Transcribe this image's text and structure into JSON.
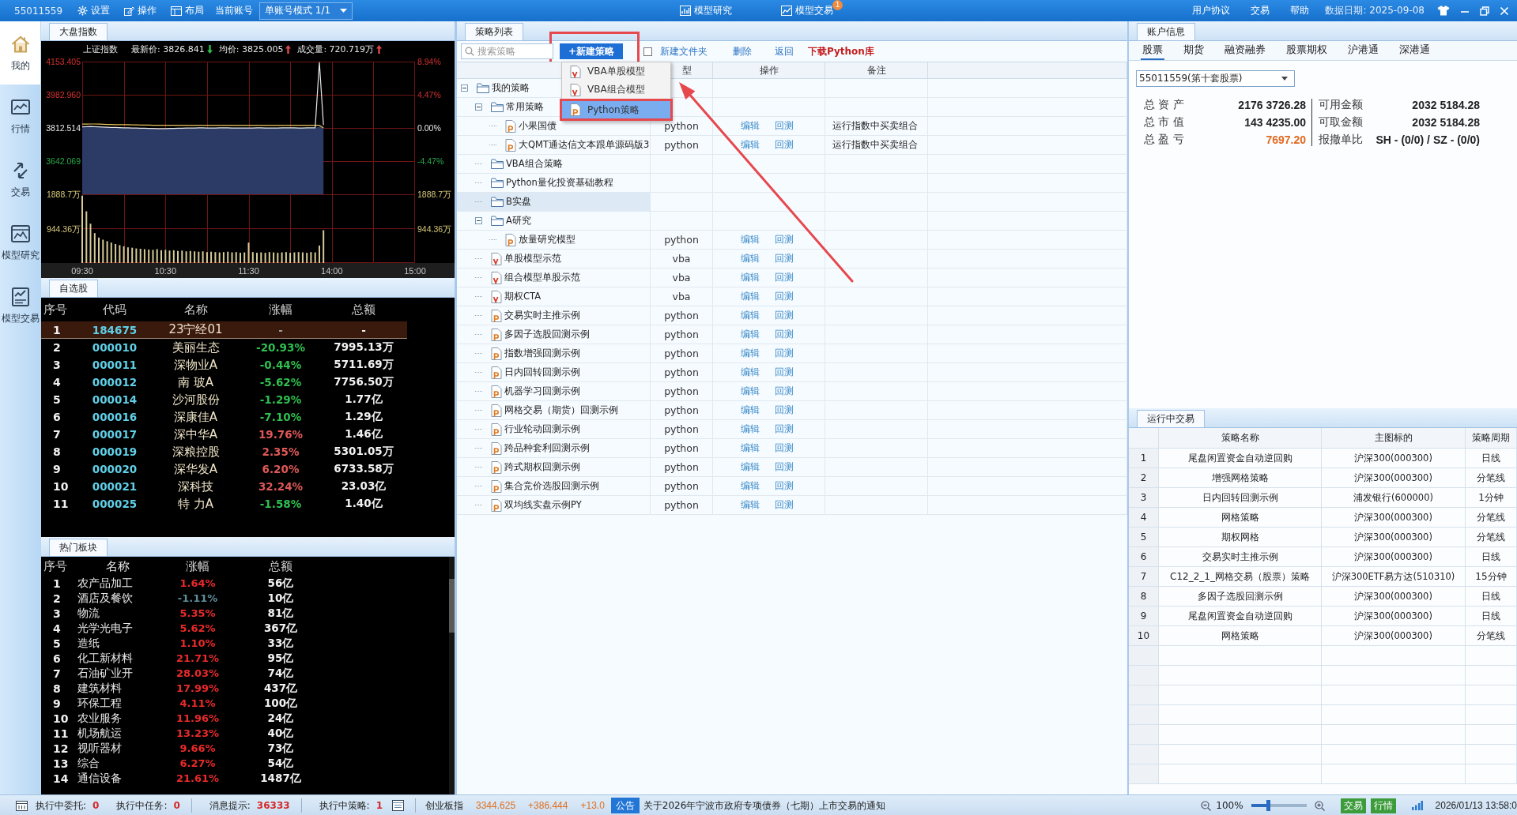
{
  "top_bar": {
    "account": "55011559",
    "menu": [
      {
        "kind": "gear",
        "label": "设置"
      },
      {
        "kind": "edit",
        "label": "操作"
      },
      {
        "kind": "layout",
        "label": "布局"
      }
    ],
    "account_label": "当前账号",
    "account_mode": "单账号模式 1/1",
    "modes": [
      {
        "kind": "research",
        "label": "模型研究"
      },
      {
        "kind": "trade",
        "label": "模型交易",
        "badge": "1"
      }
    ],
    "links": [
      "用户协议",
      "交易",
      "帮助"
    ],
    "data_date": "数据日期: 2025-09-08"
  },
  "nav": [
    {
      "kind": "home",
      "label": "我的",
      "selected": true
    },
    {
      "kind": "market",
      "label": "行情",
      "selected": false
    },
    {
      "kind": "trade",
      "label": "交易",
      "selected": false
    },
    {
      "kind": "research",
      "label": "模型研究",
      "selected": false
    },
    {
      "kind": "model_trade",
      "label": "模型交易",
      "selected": false
    }
  ],
  "index_panel": {
    "tab": "大盘指数",
    "index_name": "上证指数",
    "quotes": [
      {
        "text": "最新价: 3826.841",
        "kind": "down"
      },
      {
        "text": "均价: 3825.005",
        "kind": "up"
      },
      {
        "text": "成交量: 720.719万",
        "kind": "up"
      }
    ],
    "price_chart": {
      "chart_data": {
        "type": "line",
        "categories": [
          null,
          null,
          null,
          null,
          null,
          null,
          null,
          null,
          null,
          null,
          null,
          null,
          null,
          null,
          null,
          null,
          null,
          null,
          null,
          null,
          null,
          null,
          null,
          null,
          null,
          null,
          null,
          null,
          null,
          null,
          null,
          null,
          null,
          null,
          null,
          null,
          null,
          null,
          null,
          null,
          null,
          null,
          null,
          null,
          null,
          null,
          null,
          null,
          null,
          null,
          null,
          null,
          null,
          null,
          null,
          null,
          null,
          null,
          null,
          null,
          null,
          null,
          null,
          null,
          null,
          null,
          null,
          null,
          null,
          null,
          null,
          null,
          null,
          null,
          null,
          null,
          null,
          null,
          null,
          null,
          null
        ],
        "series": [
          {
            "color": "#e8e8e8",
            "values": [
              3818,
              3819,
              3820,
              3819,
              3818,
              3817,
              3816,
              3815,
              3815,
              3814,
              3813,
              3813,
              3812,
              3812,
              3811,
              3811,
              3810,
              3810,
              3809,
              3809,
              3809,
              3810,
              3810,
              3811,
              3811,
              3812,
              3812,
              3812,
              3813,
              3813,
              3812,
              3812,
              3812,
              3813,
              3813,
              3813,
              3812,
              3812,
              3812,
              3812,
              3812,
              3812,
              3813,
              3813,
              3812,
              3812,
              3812,
              3812,
              3813,
              3813,
              3813,
              3813,
              3812,
              3812,
              3813,
              3813,
              3813,
              4150,
              3827,
              null,
              null,
              null,
              null,
              null,
              null,
              null,
              null,
              null,
              null,
              null,
              null,
              null,
              null,
              null,
              null,
              null,
              null,
              null,
              null,
              null,
              null
            ]
          },
          {
            "color": "#e6c35c",
            "values": [
              3832,
              3832,
              3833,
              3833,
              3832,
              3831,
              3830,
              3830,
              3829,
              3829,
              3829,
              3829,
              3828,
              3828,
              3827,
              3827,
              3827,
              3826,
              3826,
              3826,
              3826,
              3826,
              3826,
              3826,
              3826,
              3826,
              3826,
              3826,
              3826,
              3826,
              3826,
              3826,
              3826,
              3826,
              3826,
              3826,
              3826,
              3826,
              3826,
              3826,
              3826,
              3826,
              3826,
              3826,
              3826,
              3826,
              3826,
              3826,
              3826,
              3826,
              3826,
              3826,
              3826,
              3826,
              3826,
              3826,
              3826,
              3826,
              3813,
              null,
              null,
              null,
              null,
              null,
              null,
              null,
              null,
              null,
              null,
              null,
              null,
              null,
              null,
              null,
              null,
              null,
              null,
              null,
              null,
              null,
              null
            ]
          }
        ],
        "ylim": [
          3642.069,
          4153.405
        ],
        "yticks": [
          {
            "value": 4153.405,
            "label": "4153.405"
          },
          {
            "value": 3982.96,
            "label": "3982.960"
          },
          {
            "value": 3812.514,
            "label": "3812.514"
          },
          {
            "value": 3642.069,
            "label": "3642.069"
          }
        ]
      }
    },
    "right_ticks": [
      {
        "label": "8.94%",
        "color": "#d83030"
      },
      {
        "label": "4.47%",
        "color": "#d83030"
      },
      {
        "label": "0.00%",
        "color": "#e8e8e8"
      },
      {
        "label": "-4.47%",
        "color": "#2aa84a"
      }
    ],
    "volume_chart": {
      "chart_data": {
        "type": "bar",
        "categories": [
          "09:30",
          null,
          null,
          null,
          null,
          null,
          null,
          null,
          null,
          null,
          null,
          null,
          null,
          null,
          null,
          null,
          null,
          null,
          null,
          null,
          "10:30",
          null,
          null,
          null,
          null,
          null,
          null,
          null,
          null,
          null,
          null,
          null,
          null,
          null,
          null,
          null,
          null,
          null,
          null,
          null,
          "11:30",
          null,
          null,
          null,
          null,
          null,
          null,
          null,
          null,
          null,
          null,
          null,
          null,
          null,
          null,
          null,
          null,
          null,
          null,
          null,
          "14:00",
          null,
          null,
          null,
          null,
          null,
          null,
          null,
          null,
          null,
          null,
          null,
          null,
          null,
          null,
          null,
          null,
          null,
          null,
          null,
          "15:00"
        ],
        "series": [
          {
            "color": "#d6cc98",
            "values": [
              1850,
              1420,
              1080,
              820,
              700,
              640,
              600,
              560,
              520,
              490,
              460,
              430,
              420,
              400,
              390,
              380,
              370,
              360,
              380,
              350,
              360,
              340,
              350,
              330,
              340,
              320,
              330,
              320,
              310,
              320,
              300,
              310,
              300,
              290,
              300,
              310,
              290,
              300,
              280,
              290,
              560,
              300,
              280,
              290,
              280,
              300,
              290,
              280,
              290,
              300,
              280,
              290,
              300,
              290,
              280,
              300,
              290,
              480,
              900,
              null,
              null,
              null,
              null,
              null,
              null,
              null,
              null,
              null,
              null,
              null,
              null,
              null,
              null,
              null,
              null,
              null,
              null,
              null,
              null,
              null,
              null
            ]
          }
        ],
        "ylim": [
          0,
          1888.7
        ],
        "yticks": [
          {
            "value": 1888.7,
            "label": "1888.7万"
          },
          {
            "value": 944.36,
            "label": "944.36万"
          }
        ]
      }
    },
    "volume_right_ticks": [
      "1888.7万",
      "944.36万"
    ]
  },
  "watchlist": {
    "tab": "自选股",
    "columns": [
      "序号",
      "代码",
      "名称",
      "涨幅",
      "总额"
    ],
    "rows": [
      {
        "no": "1",
        "code": "184675",
        "name": "23宁经01",
        "change": "-",
        "total": "-",
        "color": "#9a9a9a",
        "selected": true
      },
      {
        "no": "2",
        "code": "000010",
        "name": "美丽生态",
        "change": "-20.93%",
        "total": "7995.13万",
        "color": "#2fbf4f",
        "selected": false
      },
      {
        "no": "3",
        "code": "000011",
        "name": "深物业A",
        "change": "-0.44%",
        "total": "5711.69万",
        "color": "#2fbf4f",
        "selected": false
      },
      {
        "no": "4",
        "code": "000012",
        "name": "南 玻A",
        "change": "-5.62%",
        "total": "7756.50万",
        "color": "#2fbf4f",
        "selected": false
      },
      {
        "no": "5",
        "code": "000014",
        "name": "沙河股份",
        "change": "-1.29%",
        "total": "1.77亿",
        "color": "#2fbf4f",
        "selected": false
      },
      {
        "no": "6",
        "code": "000016",
        "name": "深康佳A",
        "change": "-7.10%",
        "total": "1.29亿",
        "color": "#2fbf4f",
        "selected": false
      },
      {
        "no": "7",
        "code": "000017",
        "name": "深中华A",
        "change": "19.76%",
        "total": "1.46亿",
        "color": "#e05858",
        "selected": false
      },
      {
        "no": "8",
        "code": "000019",
        "name": "深粮控股",
        "change": "2.35%",
        "total": "5301.05万",
        "color": "#e05858",
        "selected": false
      },
      {
        "no": "9",
        "code": "000020",
        "name": "深华发A",
        "change": "6.20%",
        "total": "6733.58万",
        "color": "#e05858",
        "selected": false
      },
      {
        "no": "10",
        "code": "000021",
        "name": "深科技",
        "change": "32.24%",
        "total": "23.03亿",
        "color": "#e05858",
        "selected": false
      },
      {
        "no": "11",
        "code": "000025",
        "name": "特 力A",
        "change": "-1.58%",
        "total": "1.40亿",
        "color": "#2fbf4f",
        "selected": false
      }
    ]
  },
  "hot_sectors": {
    "tab": "热门板块",
    "columns": [
      "序号",
      "名称",
      "涨幅",
      "总额"
    ],
    "rows": [
      {
        "no": "1",
        "name": "农产品加工",
        "change": "1.64%",
        "total": "56亿",
        "color": "#ea2a2a"
      },
      {
        "no": "2",
        "name": "酒店及餐饮",
        "change": "-1.11%",
        "total": "10亿",
        "color": "#5e8e9a"
      },
      {
        "no": "3",
        "name": "物流",
        "change": "5.35%",
        "total": "81亿",
        "color": "#ea2a2a"
      },
      {
        "no": "4",
        "name": "光学光电子",
        "change": "5.62%",
        "total": "367亿",
        "color": "#ea2a2a"
      },
      {
        "no": "5",
        "name": "造纸",
        "change": "1.10%",
        "total": "33亿",
        "color": "#ea2a2a"
      },
      {
        "no": "6",
        "name": "化工新材料",
        "change": "21.71%",
        "total": "95亿",
        "color": "#ea2a2a"
      },
      {
        "no": "7",
        "name": "石油矿业开",
        "change": "28.03%",
        "total": "74亿",
        "color": "#ea2a2a"
      },
      {
        "no": "8",
        "name": "建筑材料",
        "change": "17.99%",
        "total": "437亿",
        "color": "#ea2a2a"
      },
      {
        "no": "9",
        "name": "环保工程",
        "change": "4.11%",
        "total": "100亿",
        "color": "#ea2a2a"
      },
      {
        "no": "10",
        "name": "农业服务",
        "change": "11.96%",
        "total": "24亿",
        "color": "#ea2a2a"
      },
      {
        "no": "11",
        "name": "机场航运",
        "change": "13.23%",
        "total": "40亿",
        "color": "#ea2a2a"
      },
      {
        "no": "12",
        "name": "视听器材",
        "change": "9.66%",
        "total": "73亿",
        "color": "#ea2a2a"
      },
      {
        "no": "13",
        "name": "综合",
        "change": "6.27%",
        "total": "54亿",
        "color": "#ea2a2a"
      },
      {
        "no": "14",
        "name": "通信设备",
        "change": "21.61%",
        "total": "1487亿",
        "color": "#ea2a2a"
      }
    ]
  },
  "strategy_list": {
    "tab": "策略列表",
    "search": {
      "placeholder": "搜索策略"
    },
    "new_button": {
      "label": "+新建策略",
      "highlighted": true
    },
    "toolbar_links": [
      {
        "kind": "normal",
        "label": "新建文件夹"
      },
      {
        "kind": "normal",
        "label": "删除"
      },
      {
        "kind": "normal",
        "label": "返回"
      },
      {
        "kind": "download",
        "label": "下载Python库"
      }
    ],
    "columns": [
      "型",
      "操作",
      "备注"
    ],
    "tree": [
      {
        "kind": "folder",
        "name": "我的策略",
        "expanded": true,
        "selected": false,
        "children": [
          {
            "kind": "folder",
            "name": "常用策略",
            "expanded": true,
            "selected": false,
            "children": [
              {
                "kind": "python",
                "name": "小果国债",
                "selected": false,
                "type": "python",
                "actions": [
                  "编辑",
                  "回测"
                ],
                "note": "运行指数中买卖组合"
              },
              {
                "kind": "python",
                "name": "大QMT通达信文本跟单源码版3",
                "selected": false,
                "type": "python",
                "actions": [
                  "编辑",
                  "回测"
                ],
                "note": "运行指数中买卖组合"
              }
            ]
          },
          {
            "kind": "folder",
            "name": "VBA组合策略",
            "selected": false
          },
          {
            "kind": "folder",
            "name": "Python量化投资基础教程",
            "selected": false
          },
          {
            "kind": "folder",
            "name": "B实盘",
            "selected": true
          },
          {
            "kind": "folder",
            "name": "A研究",
            "expanded": true,
            "selected": false,
            "children": [
              {
                "kind": "python",
                "name": "放量研究模型",
                "selected": false,
                "type": "python",
                "actions": [
                  "编辑",
                  "回测"
                ]
              }
            ]
          },
          {
            "kind": "vba",
            "name": "单股模型示范",
            "selected": false,
            "type": "vba",
            "actions": [
              "编辑",
              "回测"
            ]
          },
          {
            "kind": "vba",
            "name": "组合模型单股示范",
            "selected": false,
            "type": "vba",
            "actions": [
              "编辑",
              "回测"
            ]
          },
          {
            "kind": "vba",
            "name": "期权CTA",
            "selected": false,
            "type": "vba",
            "actions": [
              "编辑",
              "回测"
            ]
          },
          {
            "kind": "python",
            "name": "交易实时主推示例",
            "selected": false,
            "type": "python",
            "actions": [
              "编辑",
              "回测"
            ]
          },
          {
            "kind": "python",
            "name": "多因子选股回测示例",
            "selected": false,
            "type": "python",
            "actions": [
              "编辑",
              "回测"
            ]
          },
          {
            "kind": "python",
            "name": "指数增强回测示例",
            "selected": false,
            "type": "python",
            "actions": [
              "编辑",
              "回测"
            ]
          },
          {
            "kind": "python",
            "name": "日内回转回测示例",
            "selected": false,
            "type": "python",
            "actions": [
              "编辑",
              "回测"
            ]
          },
          {
            "kind": "python",
            "name": "机器学习回测示例",
            "selected": false,
            "type": "python",
            "actions": [
              "编辑",
              "回测"
            ]
          },
          {
            "kind": "python",
            "name": "网格交易（期货）回测示例",
            "selected": false,
            "type": "python",
            "actions": [
              "编辑",
              "回测"
            ]
          },
          {
            "kind": "python",
            "name": "行业轮动回测示例",
            "selected": false,
            "type": "python",
            "actions": [
              "编辑",
              "回测"
            ]
          },
          {
            "kind": "python",
            "name": "跨品种套利回测示例",
            "selected": false,
            "type": "python",
            "actions": [
              "编辑",
              "回测"
            ]
          },
          {
            "kind": "python",
            "name": "跨式期权回测示例",
            "selected": false,
            "type": "python",
            "actions": [
              "编辑",
              "回测"
            ]
          },
          {
            "kind": "python",
            "name": "集合竞价选股回测示例",
            "selected": false,
            "type": "python",
            "actions": [
              "编辑",
              "回测"
            ]
          },
          {
            "kind": "python",
            "name": "双均线实盘示例PY",
            "selected": false,
            "type": "python",
            "actions": [
              "编辑",
              "回测"
            ]
          }
        ]
      }
    ],
    "new_menu": [
      {
        "kind": "vba",
        "label": "VBA单股模型",
        "selected": false,
        "highlighted": false
      },
      {
        "kind": "vba",
        "label": "VBA组合模型",
        "selected": false,
        "highlighted": false
      },
      {
        "kind": "python",
        "label": "Python策略",
        "selected": true,
        "highlighted": true
      }
    ],
    "callout_arrow": true
  },
  "account_info": {
    "tab": "账户信息",
    "tabs": [
      {
        "label": "股票",
        "selected": true
      },
      {
        "label": "期货",
        "selected": false
      },
      {
        "label": "融资融券",
        "selected": false
      },
      {
        "label": "股票期权",
        "selected": false
      },
      {
        "label": "沪港通",
        "selected": false
      },
      {
        "label": "深港通",
        "selected": false
      }
    ],
    "account_select": "55011559(第十套股票)",
    "left_fields": [
      {
        "label": "总 资 产",
        "value": "2176 3726.28",
        "kind": "plain"
      },
      {
        "label": "总 市 值",
        "value": "143 4235.00",
        "kind": "plain"
      },
      {
        "label": "总 盈 亏",
        "value": "7697.20",
        "kind": "gain"
      }
    ],
    "right_fields": [
      {
        "label": "可用金额",
        "value": "2032 5184.28",
        "kind": "plain"
      },
      {
        "label": "可取金额",
        "value": "2032 5184.28",
        "kind": "plain"
      },
      {
        "label": "报撤单比",
        "value": "SH - (0/0) / SZ - (0/0)",
        "kind": "plain"
      }
    ]
  },
  "running_trades": {
    "tab": "运行中交易",
    "columns": [
      "策略名称",
      "主图标的",
      "策略周期"
    ],
    "rows": [
      {
        "no": "1",
        "name": "尾盘闲置资金自动逆回购",
        "symbol": "沪深300(000300)",
        "period": "日线"
      },
      {
        "no": "2",
        "name": "增强网格策略",
        "symbol": "沪深300(000300)",
        "period": "分笔线"
      },
      {
        "no": "3",
        "name": "日内回转回测示例",
        "symbol": "浦发银行(600000)",
        "period": "1分钟"
      },
      {
        "no": "4",
        "name": "网格策略",
        "symbol": "沪深300(000300)",
        "period": "分笔线"
      },
      {
        "no": "5",
        "name": "期权网格",
        "symbol": "沪深300(000300)",
        "period": "分笔线"
      },
      {
        "no": "6",
        "name": "交易实时主推示例",
        "symbol": "沪深300(000300)",
        "period": "日线"
      },
      {
        "no": "7",
        "name": "C12_2_1_网格交易（股票）策略",
        "symbol": "沪深300ETF易方达(510310)",
        "period": "15分钟"
      },
      {
        "no": "8",
        "name": "多因子选股回测示例",
        "symbol": "沪深300(000300)",
        "period": "日线"
      },
      {
        "no": "9",
        "name": "尾盘闲置资金自动逆回购",
        "symbol": "沪深300(000300)",
        "period": "日线"
      },
      {
        "no": "10",
        "name": "网格策略",
        "symbol": "沪深300(000300)",
        "period": "分笔线"
      }
    ]
  },
  "status_bar": {
    "counters": [
      {
        "label": "执行中委托:",
        "value": "0"
      },
      {
        "label": "执行中任务:",
        "value": "0"
      },
      {
        "label": "消息提示:",
        "value": "36333"
      },
      {
        "label": "执行中策略:",
        "value": "1"
      }
    ],
    "index_name": "创业板指",
    "index_values": [
      "3344.625",
      "+386.444",
      "+13.0"
    ],
    "notice_tag": "公告",
    "notice": "关于2026年宁波市政府专项债券（七期）上市交易的通知",
    "zoom": {
      "label": "100%",
      "level": 0.3
    },
    "badges": [
      "交易",
      "行情"
    ],
    "clock": "2026/01/13 13:58:0"
  }
}
